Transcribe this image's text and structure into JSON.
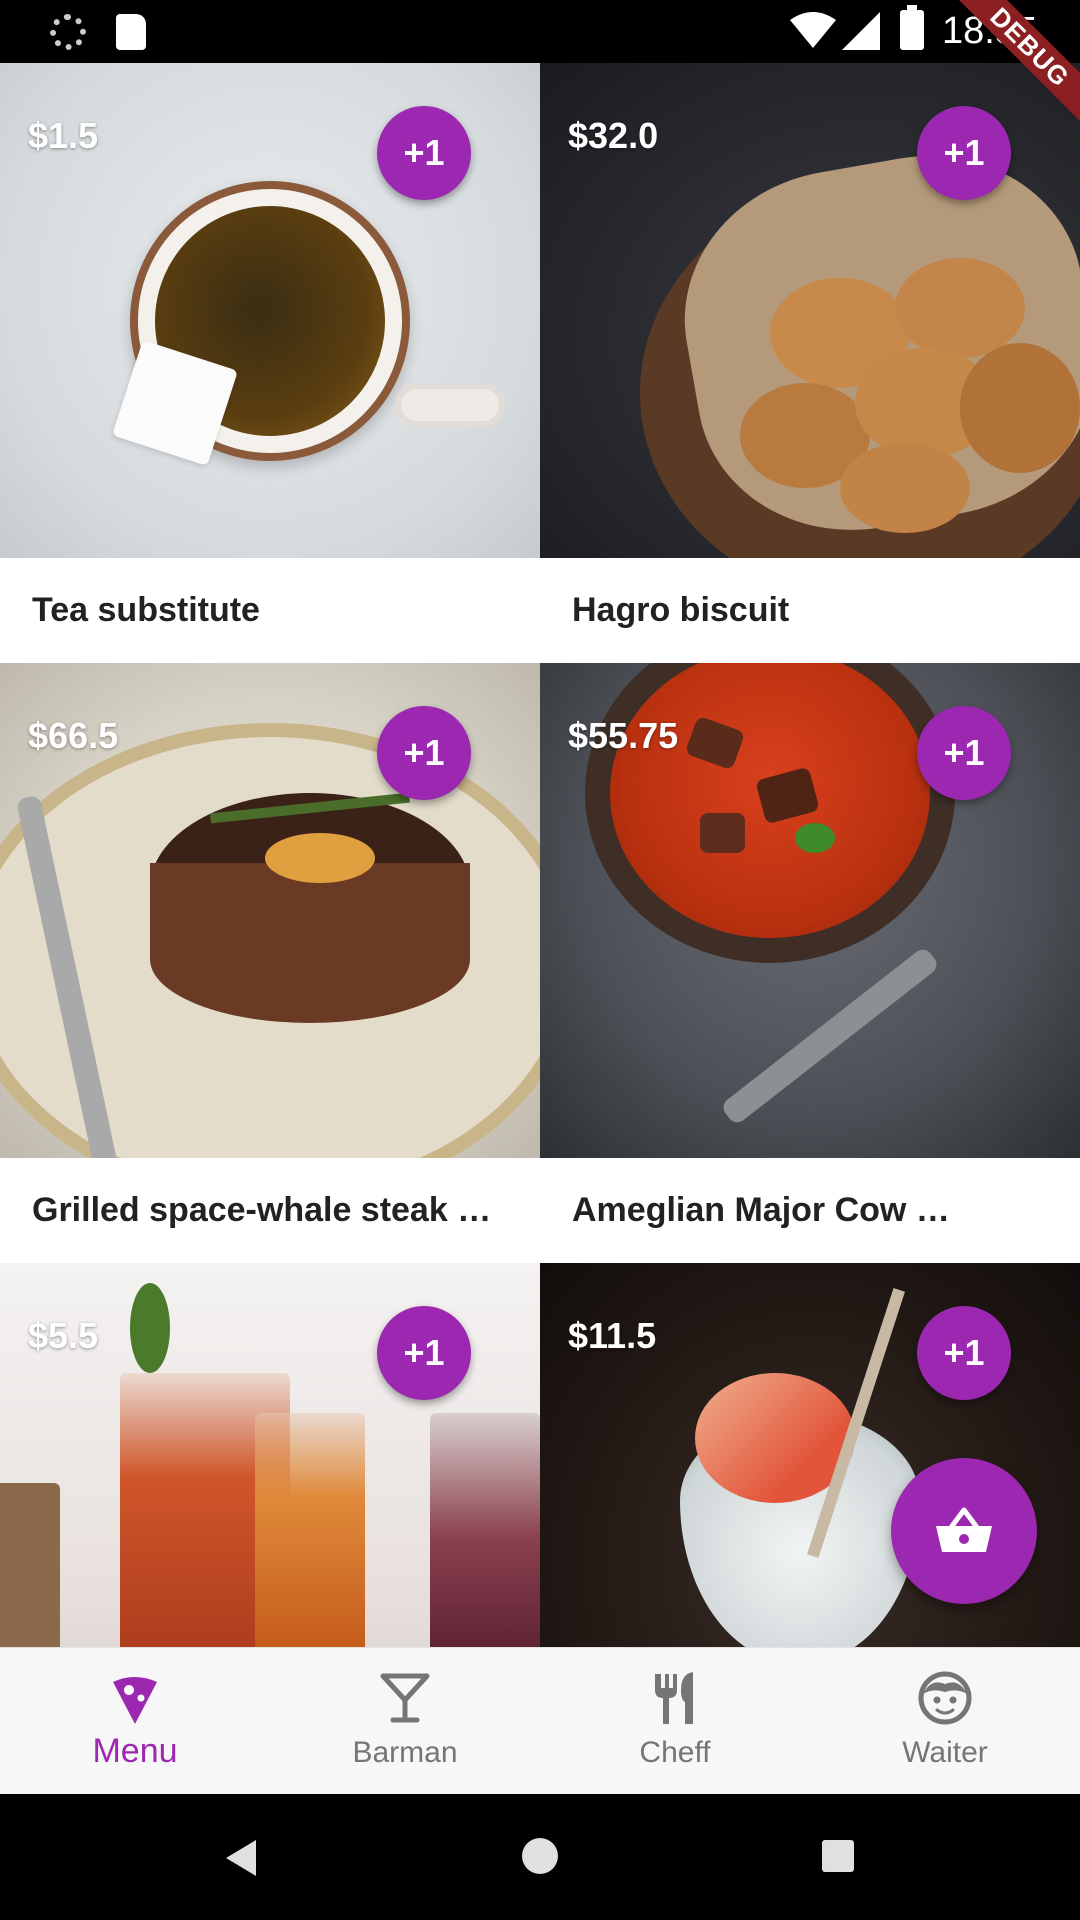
{
  "status_bar": {
    "time": "18:55",
    "icons": [
      "loading-icon",
      "sd-card-icon",
      "wifi-icon",
      "signal-icon",
      "battery-icon"
    ]
  },
  "debug_banner": "DEBUG",
  "products": [
    {
      "price": "$1.5",
      "name": "Tea substitute",
      "add_label": "+1",
      "image": "tea-cup-photo"
    },
    {
      "price": "$32.0",
      "name": "Hagro biscuit",
      "add_label": "+1",
      "image": "cookies-basket-photo"
    },
    {
      "price": "$66.5",
      "name": "Grilled space-whale steak …",
      "add_label": "+1",
      "image": "steak-plate-photo"
    },
    {
      "price": "$55.75",
      "name": "Ameglian Major Cow …",
      "add_label": "+1",
      "image": "stew-bowl-photo"
    },
    {
      "price": "$5.5",
      "name": "",
      "add_label": "+1",
      "image": "iced-tea-glasses-photo"
    },
    {
      "price": "$11.5",
      "name": "",
      "add_label": "+1",
      "image": "gin-tonic-glass-photo"
    }
  ],
  "fab": {
    "icon": "basket-icon"
  },
  "bottom_nav": {
    "items": [
      {
        "label": "Menu",
        "icon": "pizza-slice-icon",
        "active": true
      },
      {
        "label": "Barman",
        "icon": "cocktail-glass-icon",
        "active": false
      },
      {
        "label": "Cheff",
        "icon": "fork-knife-icon",
        "active": false
      },
      {
        "label": "Waiter",
        "icon": "waiter-face-icon",
        "active": false
      }
    ]
  },
  "system_nav": {
    "icons": [
      "back-icon",
      "home-icon",
      "recents-icon"
    ]
  },
  "colors": {
    "accent": "#9c27b0",
    "inactive": "#757575",
    "nav_bg": "#f7f7f7"
  }
}
